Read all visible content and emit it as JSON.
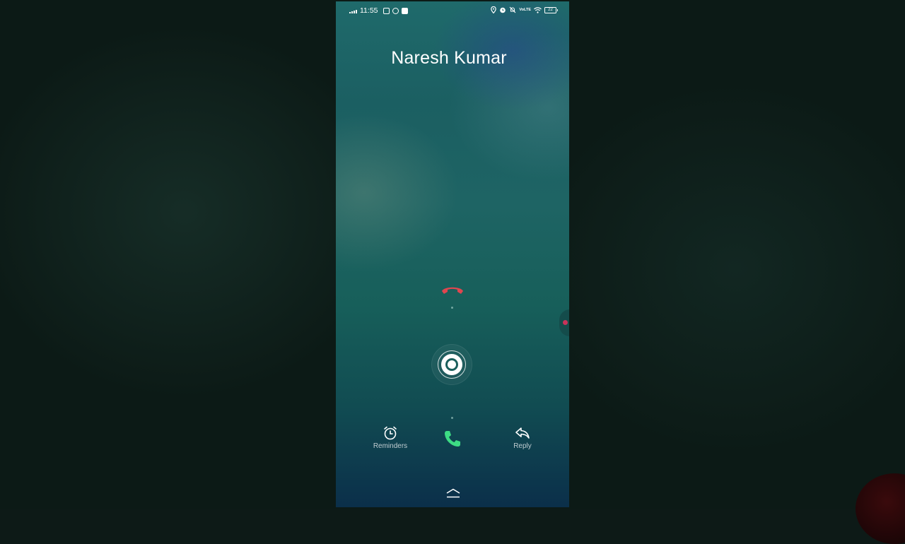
{
  "status_bar": {
    "time": "11:55",
    "left_icons": [
      "signal-icon",
      "photo-notification-icon",
      "messenger-icon",
      "chat-icon"
    ],
    "right_icons": [
      "location-icon",
      "alarm-icon",
      "mute-icon",
      "volte-icon",
      "wifi-icon",
      "battery-icon"
    ],
    "volte_text": "VoLTE",
    "battery_level": "22"
  },
  "call": {
    "caller_name": "Naresh Kumar"
  },
  "actions": {
    "reminders_label": "Reminders",
    "reply_label": "Reply"
  },
  "colors": {
    "decline": "#e0464f",
    "answer": "#3ddc84"
  },
  "icons": {
    "decline": "phone-hangup-icon",
    "swipe": "swipe-handle-icon",
    "answer": "phone-icon",
    "reminders": "alarm-clock-icon",
    "reply": "reply-arrow-icon",
    "home": "home-icon"
  }
}
